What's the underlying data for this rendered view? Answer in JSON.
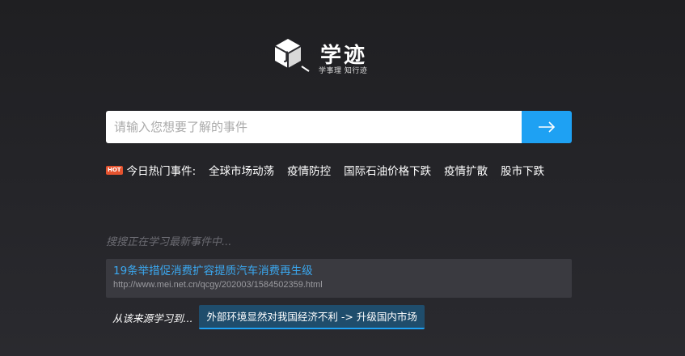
{
  "logo": {
    "title": "学迹",
    "subtitle": "学事理 知行迹",
    "icon": "cube-j-icon"
  },
  "search": {
    "placeholder": "请输入您想要了解的事件",
    "value": "",
    "button_icon": "arrow-right-icon"
  },
  "hot": {
    "badge": "HOT",
    "label": "今日热门事件:",
    "topics": [
      "全球市场动荡",
      "疫情防控",
      "国际石油价格下跌",
      "疫情扩散",
      "股市下跌"
    ]
  },
  "status_text": "搜搜正在学习最新事件中...",
  "result": {
    "title": "19条举措促消费扩容提质汽车消费再生级",
    "url": "http://www.mei.net.cn/qcgy/202003/1584502359.html"
  },
  "learned": {
    "label": "从该来源学习到...",
    "chip": "外部环境显然对我国经济不利 -> 升级国内市场"
  },
  "colors": {
    "accent": "#1ea1f3",
    "hot": "#e5532f",
    "link": "#3aa8f0"
  }
}
